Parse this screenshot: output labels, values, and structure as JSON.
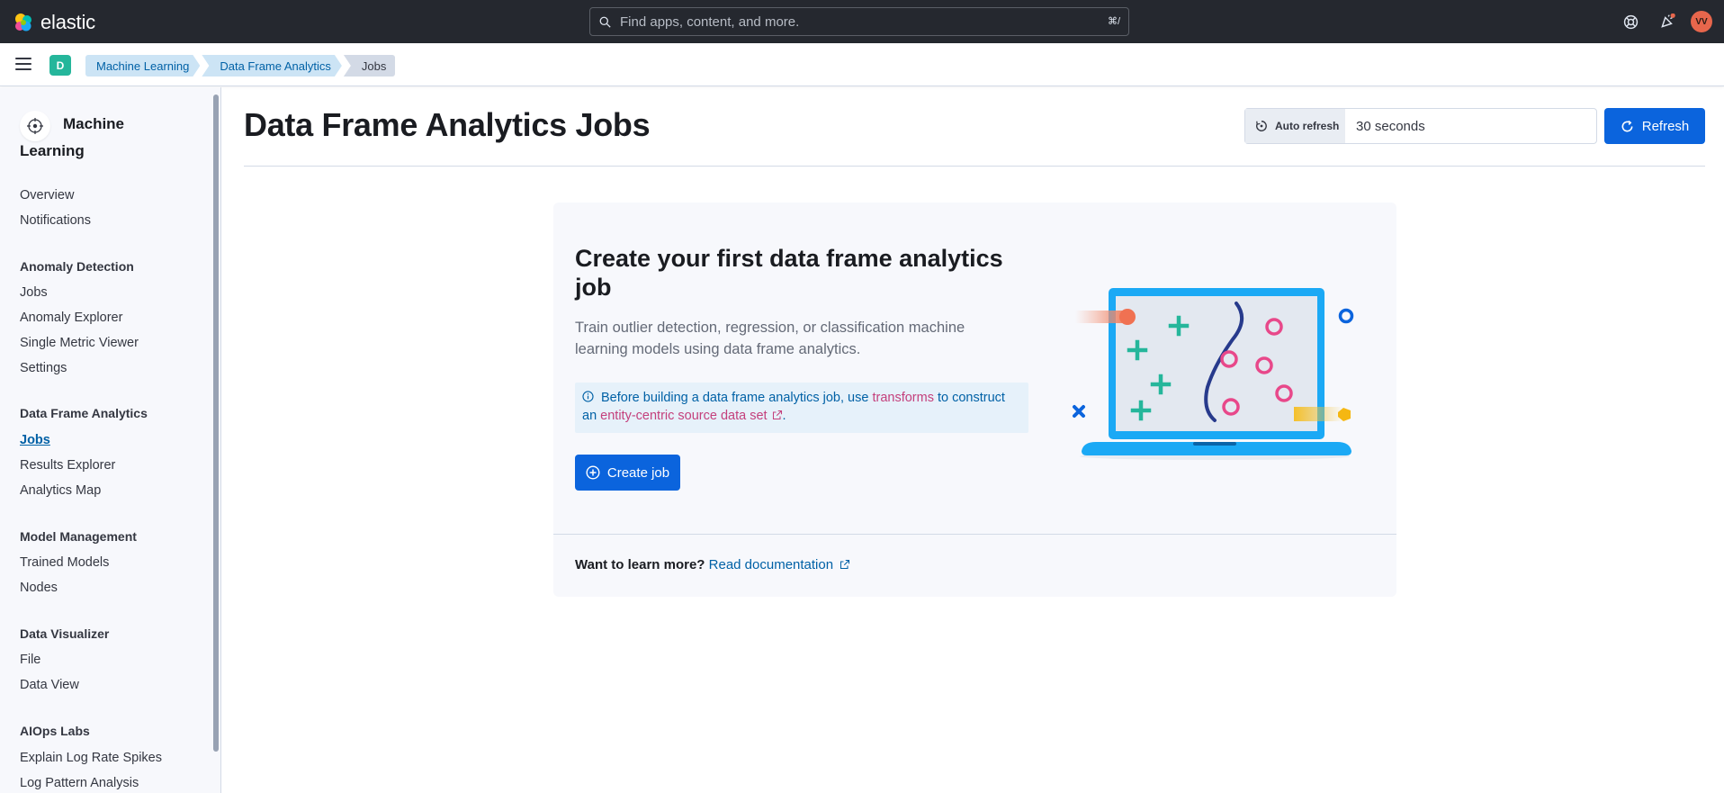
{
  "header": {
    "brand": "elastic",
    "search_placeholder": "Find apps, content, and more.",
    "search_shortcut": "⌘/",
    "user_initials": "VV"
  },
  "breadcrumbs": {
    "space": "D",
    "items": [
      "Machine Learning",
      "Data Frame Analytics",
      "Jobs"
    ]
  },
  "sidebar": {
    "title": "Machine Learning",
    "top_items": [
      "Overview",
      "Notifications"
    ],
    "groups": [
      {
        "label": "Anomaly Detection",
        "items": [
          "Jobs",
          "Anomaly Explorer",
          "Single Metric Viewer",
          "Settings"
        ]
      },
      {
        "label": "Data Frame Analytics",
        "items": [
          "Jobs",
          "Results Explorer",
          "Analytics Map"
        ]
      },
      {
        "label": "Model Management",
        "items": [
          "Trained Models",
          "Nodes"
        ]
      },
      {
        "label": "Data Visualizer",
        "items": [
          "File",
          "Data View"
        ]
      },
      {
        "label": "AIOps Labs",
        "items": [
          "Explain Log Rate Spikes",
          "Log Pattern Analysis"
        ]
      }
    ],
    "active_item": "Data Frame Analytics / Jobs"
  },
  "main": {
    "page_title": "Data Frame Analytics Jobs",
    "auto_refresh_label": "Auto refresh",
    "auto_refresh_value": "30 seconds",
    "refresh_button": "Refresh",
    "empty": {
      "title": "Create your first data frame analytics job",
      "description": "Train outlier detection, regression, or classification machine learning models using data frame analytics.",
      "callout": {
        "text_1": "Before building a data frame analytics job, use ",
        "link_1": "transforms",
        "text_2": " to construct an ",
        "link_2": "entity-centric source data set",
        "text_3": "."
      },
      "create_button": "Create job",
      "learn_more_label": "Want to learn more?",
      "learn_more_link": "Read documentation"
    }
  },
  "colors": {
    "header_bg": "#25282f",
    "primary": "#0b64dd",
    "link": "#0061a6",
    "accent_pink": "#c4407c",
    "space_badge": "#25b69b",
    "avatar": "#e7664c"
  }
}
